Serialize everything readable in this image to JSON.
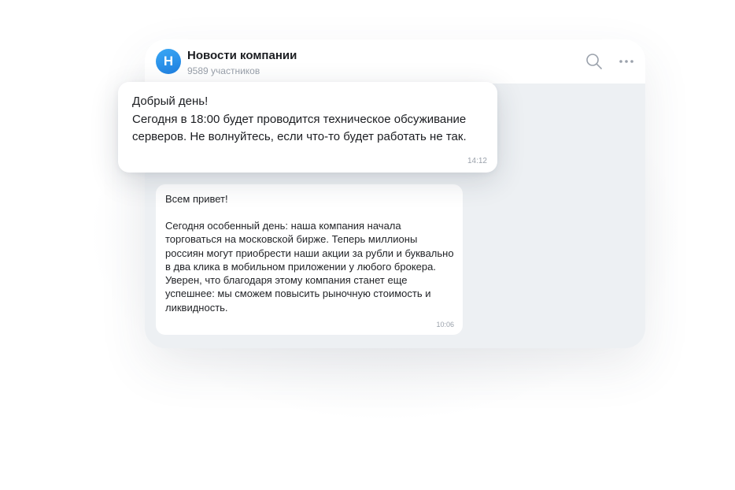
{
  "channel": {
    "avatar_letter": "Н",
    "title": "Новости компании",
    "subtitle": "9589 участников",
    "avatar_color": "#2a90ec"
  },
  "header_icons": [
    "search-icon",
    "more-icon"
  ],
  "popup_message": {
    "line1": "Добрый день!",
    "line2": "Сегодня в 18:00 будет проводится техническое обсуживание серверов. Не волнуйтесь, если что-то будет работать не так.",
    "time": "14:12"
  },
  "chat_message": {
    "greeting": "Всем привет!",
    "body": "Сегодня особенный день: наша компания начала торговаться на московской бирже. Теперь миллионы россиян могут приобрести наши акции за рубли и буквально в два клика в мобильном приложении у любого брокера. Уверен, что благодаря этому компания станет еще успешнее: мы сможем повысить рыночную стоимость и ликвидность.",
    "time": "10:06"
  },
  "colors": {
    "chat_background": "#edf0f3",
    "bubble": "#ffffff",
    "muted_text": "#9aa1ab"
  }
}
